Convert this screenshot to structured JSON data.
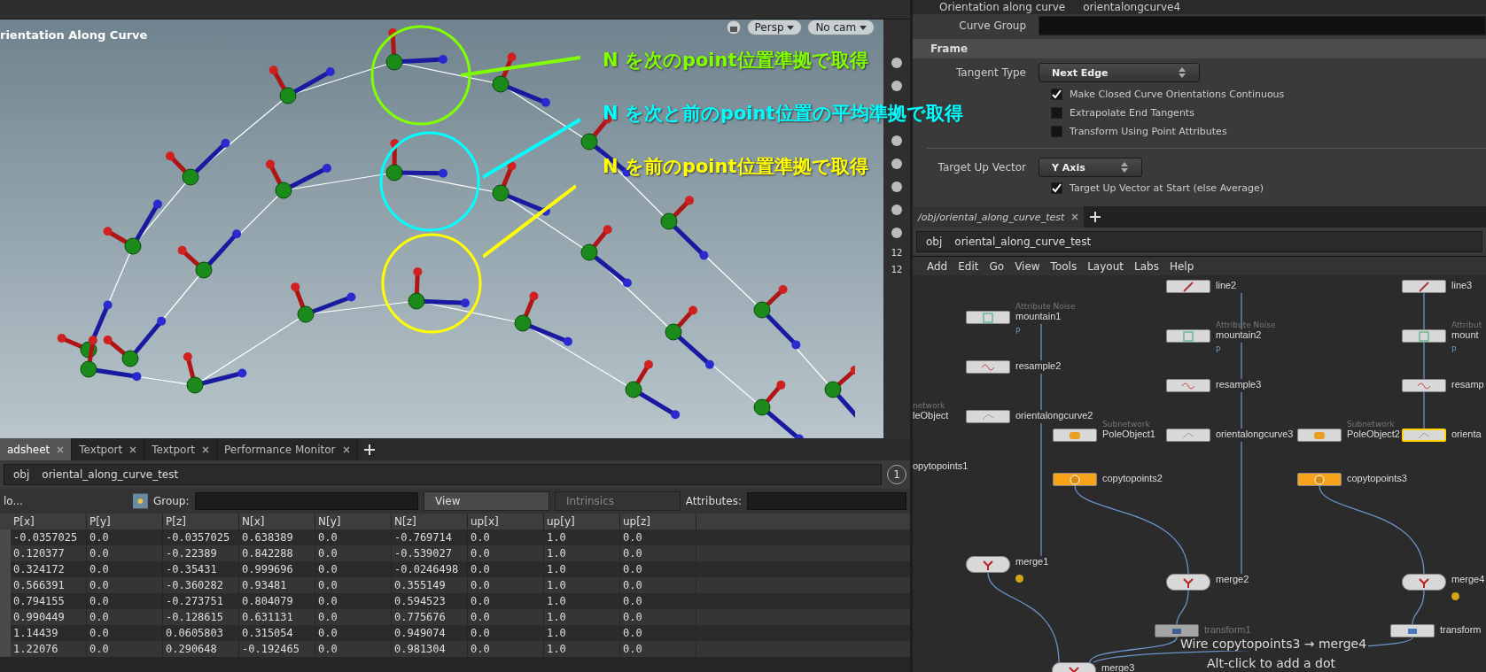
{
  "viewport": {
    "title": "rientation Along Curve",
    "camera_buttons": [
      "Persp",
      "No cam"
    ],
    "annotations": [
      {
        "text": "N を次のpoint位置準拠で取得",
        "color": "#7fff00"
      },
      {
        "text": "N を次と前のpoint位置の平均準拠で取得",
        "color": "#00ffff"
      },
      {
        "text": "N を前のpoint位置準拠で取得",
        "color": "#ffff00"
      }
    ],
    "toolbar_labels": [
      "12",
      "12"
    ]
  },
  "spreadsheet": {
    "tabs": [
      {
        "label": "adsheet",
        "selected": true
      },
      {
        "label": "Textport",
        "selected": false
      },
      {
        "label": "Textport",
        "selected": false
      },
      {
        "label": "Performance Monitor",
        "selected": false
      }
    ],
    "path": [
      "obj",
      "oriental_along_curve_test"
    ],
    "frame_badge": "1",
    "toolbar": {
      "node_label": "lo...",
      "group_label": "Group:",
      "view": "View",
      "intrinsics": "Intrinsics",
      "attributes_label": "Attributes:"
    },
    "columns": [
      "P[x]",
      "P[y]",
      "P[z]",
      "N[x]",
      "N[y]",
      "N[z]",
      "up[x]",
      "up[y]",
      "up[z]"
    ],
    "rows": [
      [
        "-0.0357025",
        "0.0",
        "-0.0357025",
        "0.638389",
        "0.0",
        "-0.769714",
        "0.0",
        "1.0",
        "0.0"
      ],
      [
        "0.120377",
        "0.0",
        "-0.22389",
        "0.842288",
        "0.0",
        "-0.539027",
        "0.0",
        "1.0",
        "0.0"
      ],
      [
        "0.324172",
        "0.0",
        "-0.35431",
        "0.999696",
        "0.0",
        "-0.0246498",
        "0.0",
        "1.0",
        "0.0"
      ],
      [
        "0.566391",
        "0.0",
        "-0.360282",
        "0.93481",
        "0.0",
        "0.355149",
        "0.0",
        "1.0",
        "0.0"
      ],
      [
        "0.794155",
        "0.0",
        "-0.273751",
        "0.804079",
        "0.0",
        "0.594523",
        "0.0",
        "1.0",
        "0.0"
      ],
      [
        "0.990449",
        "0.0",
        "-0.128615",
        "0.631131",
        "0.0",
        "0.775676",
        "0.0",
        "1.0",
        "0.0"
      ],
      [
        "1.14439",
        "0.0",
        "0.0605803",
        "0.315054",
        "0.0",
        "0.949074",
        "0.0",
        "1.0",
        "0.0"
      ],
      [
        "1.22076",
        "0.0",
        "0.290648",
        "-0.192465",
        "0.0",
        "0.981304",
        "0.0",
        "1.0",
        "0.0"
      ]
    ]
  },
  "parameters": {
    "header": {
      "type": "Orientation along curve",
      "name": "orientalongcurve4"
    },
    "curve_group_label": "Curve Group",
    "section": "Frame",
    "tangent_type": {
      "label": "Tangent Type",
      "value": "Next Edge"
    },
    "checks": [
      {
        "label": "Make Closed Curve Orientations Continuous",
        "checked": true
      },
      {
        "label": "Extrapolate End Tangents",
        "checked": false
      },
      {
        "label": "Transform Using Point Attributes",
        "checked": false
      }
    ],
    "target_up": {
      "label": "Target Up Vector",
      "value": "Y Axis"
    },
    "target_check": {
      "label": "Target Up Vector at Start (else Average)",
      "checked": true
    }
  },
  "network": {
    "tab": {
      "label": "/obj/oriental_along_curve_test",
      "selected": true
    },
    "path": [
      "obj",
      "oriental_along_curve_test"
    ],
    "menu": [
      "Add",
      "Edit",
      "Go",
      "View",
      "Tools",
      "Layout",
      "Labs",
      "Help"
    ],
    "nodes": [
      {
        "name": "mountain1",
        "subtitle": "Attribute Noise",
        "kind": "noise",
        "flag": "P",
        "selected": false,
        "warning": false,
        "faded": false
      },
      {
        "name": "resample2",
        "kind": "resample",
        "selected": false,
        "warning": false,
        "faded": false
      },
      {
        "name": "leObject",
        "subtitle": "network",
        "kind": "label",
        "selected": false,
        "warning": false,
        "faded": false
      },
      {
        "name": "orientalongcurve2",
        "kind": "orient",
        "selected": false,
        "warning": false,
        "faded": false
      },
      {
        "name": "opytopoints1",
        "kind": "label",
        "selected": false,
        "warning": false,
        "faded": false
      },
      {
        "name": "merge1",
        "kind": "merge",
        "selected": false,
        "warning": true,
        "faded": false
      },
      {
        "name": "line2",
        "kind": "line",
        "selected": false,
        "warning": false,
        "faded": false
      },
      {
        "name": "mountain2",
        "subtitle": "Attribute Noise",
        "kind": "noise",
        "flag": "P",
        "selected": false,
        "warning": false,
        "faded": false
      },
      {
        "name": "resample3",
        "kind": "resample",
        "selected": false,
        "warning": false,
        "faded": false
      },
      {
        "name": "PoleObject1",
        "subtitle": "Subnetwork",
        "kind": "subnet",
        "selected": false,
        "warning": false,
        "faded": false
      },
      {
        "name": "orientalongcurve3",
        "kind": "orient",
        "selected": false,
        "warning": false,
        "faded": false
      },
      {
        "name": "copytopoints2",
        "kind": "copy",
        "selected": false,
        "warning": false,
        "faded": false
      },
      {
        "name": "merge2",
        "kind": "merge",
        "selected": false,
        "warning": false,
        "faded": false
      },
      {
        "name": "transform1",
        "kind": "transform",
        "selected": false,
        "warning": false,
        "faded": true
      },
      {
        "name": "line3",
        "kind": "line",
        "selected": false,
        "warning": false,
        "faded": false
      },
      {
        "name": "mount",
        "subtitle": "Attribut",
        "kind": "noise",
        "flag": "P",
        "selected": false,
        "warning": false,
        "faded": false
      },
      {
        "name": "resamp",
        "kind": "resample",
        "selected": false,
        "warning": false,
        "faded": false
      },
      {
        "name": "PoleObject2",
        "subtitle": "Subnetwork",
        "kind": "subnet",
        "selected": false,
        "warning": false,
        "faded": false
      },
      {
        "name": "orienta",
        "kind": "orient",
        "selected": true,
        "warning": false,
        "faded": false
      },
      {
        "name": "copytopoints3",
        "kind": "copy",
        "selected": false,
        "warning": false,
        "faded": false
      },
      {
        "name": "merge4",
        "kind": "merge",
        "selected": false,
        "warning": true,
        "faded": false
      },
      {
        "name": "transform",
        "kind": "transform",
        "selected": false,
        "warning": false,
        "faded": false
      },
      {
        "name": "merge3",
        "kind": "merge",
        "selected": false,
        "warning": false,
        "faded": false
      }
    ],
    "tooltip": [
      "Wire copytopoints3 → merge4",
      "Alt-click to add a dot"
    ]
  }
}
